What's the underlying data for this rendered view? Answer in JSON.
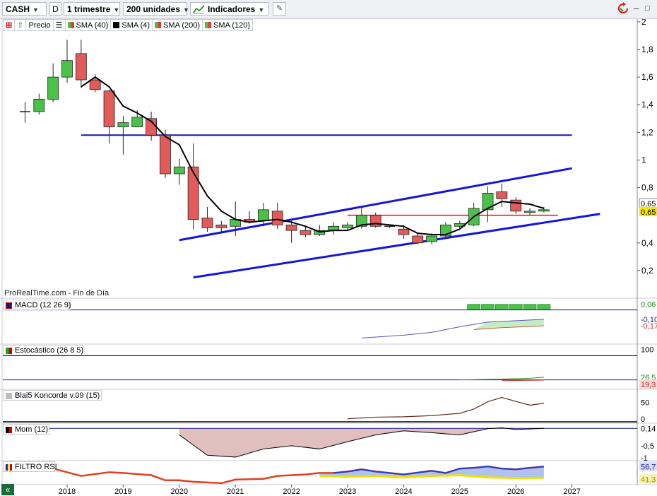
{
  "toolbar": {
    "ticker": "CASH",
    "ticker_type": "D",
    "timeframe": "1 trimestre",
    "units": "200 unidades",
    "indicators_label": "Indicadores"
  },
  "legend": [
    {
      "label": "Precio",
      "color": "#4ac24a",
      "split": false
    },
    {
      "label": "SMA (40)",
      "color": "#4ac24a",
      "split": true
    },
    {
      "label": "SMA (4)",
      "color": "#000000",
      "split": false
    },
    {
      "label": "SMA (200)",
      "color": "#4ac24a",
      "split": true
    },
    {
      "label": "SMA (120)",
      "color": "#4ac24a",
      "split": true
    }
  ],
  "watermark": "ProRealTime.com - Fin de Día",
  "panels": {
    "macd": {
      "label": "MACD (12 26 9)",
      "axis": [
        "0,06",
        "-0,10",
        "-0,17"
      ]
    },
    "stoch": {
      "label": "Estocástico (26 8 5)",
      "axis": [
        "100",
        "26,5",
        "19,3"
      ]
    },
    "koncorde": {
      "label": "Blai5 Koncorde v.09 (15)",
      "axis": [
        "50",
        "0"
      ]
    },
    "mom": {
      "label": "Mom (12)",
      "axis": [
        "0,14",
        "-0,5",
        "-1"
      ]
    },
    "rsi": {
      "label": "FILTRO RSI",
      "axis": [
        "56,7",
        "41,3"
      ]
    }
  },
  "price_axis": {
    "ticks": [
      {
        "v": 2.0,
        "t": "2"
      },
      {
        "v": 1.8,
        "t": "1,8"
      },
      {
        "v": 1.6,
        "t": "1,6"
      },
      {
        "v": 1.4,
        "t": "1,4"
      },
      {
        "v": 1.2,
        "t": "1,2"
      },
      {
        "v": 1.0,
        "t": "1"
      },
      {
        "v": 0.8,
        "t": "0,8"
      },
      {
        "v": 0.4,
        "t": "0,4"
      },
      {
        "v": 0.2,
        "t": "0,2"
      }
    ],
    "last_labels": [
      {
        "v": 0.685,
        "t": "0,65",
        "bg": "#ffffff"
      },
      {
        "v": 0.625,
        "t": "0,65",
        "bg": "#f6e700"
      }
    ]
  },
  "chart_data": {
    "type": "candlestick",
    "x_axis_labels": [
      "2018",
      "2019",
      "2020",
      "2021",
      "2022",
      "2023",
      "2024",
      "2025",
      "2026",
      "2027"
    ],
    "x_axis_years": [
      2018,
      2019,
      2020,
      2021,
      2022,
      2023,
      2024,
      2025,
      2026,
      2027
    ],
    "ylim": [
      0.0,
      2.02
    ],
    "candles": [
      {
        "t": 2017.25,
        "o": 1.35,
        "h": 1.42,
        "l": 1.27,
        "c": 1.35
      },
      {
        "t": 2017.5,
        "o": 1.35,
        "h": 1.48,
        "l": 1.33,
        "c": 1.44
      },
      {
        "t": 2017.75,
        "o": 1.44,
        "h": 1.7,
        "l": 1.42,
        "c": 1.6
      },
      {
        "t": 2018.0,
        "o": 1.6,
        "h": 1.87,
        "l": 1.56,
        "c": 1.72
      },
      {
        "t": 2018.25,
        "o": 1.77,
        "h": 1.87,
        "l": 1.52,
        "c": 1.58
      },
      {
        "t": 2018.5,
        "o": 1.58,
        "h": 1.62,
        "l": 1.49,
        "c": 1.51
      },
      {
        "t": 2018.75,
        "o": 1.5,
        "h": 1.51,
        "l": 1.12,
        "c": 1.24
      },
      {
        "t": 2019.0,
        "o": 1.24,
        "h": 1.32,
        "l": 1.04,
        "c": 1.27
      },
      {
        "t": 2019.25,
        "o": 1.24,
        "h": 1.36,
        "l": 1.24,
        "c": 1.31
      },
      {
        "t": 2019.5,
        "o": 1.3,
        "h": 1.35,
        "l": 1.14,
        "c": 1.18
      },
      {
        "t": 2019.75,
        "o": 1.18,
        "h": 1.22,
        "l": 0.87,
        "c": 0.9
      },
      {
        "t": 2020.0,
        "o": 0.9,
        "h": 1.01,
        "l": 0.82,
        "c": 0.95
      },
      {
        "t": 2020.25,
        "o": 0.95,
        "h": 1.12,
        "l": 0.5,
        "c": 0.57
      },
      {
        "t": 2020.5,
        "o": 0.58,
        "h": 0.66,
        "l": 0.48,
        "c": 0.51
      },
      {
        "t": 2020.75,
        "o": 0.53,
        "h": 0.56,
        "l": 0.47,
        "c": 0.51
      },
      {
        "t": 2021.0,
        "o": 0.52,
        "h": 0.7,
        "l": 0.45,
        "c": 0.57
      },
      {
        "t": 2021.25,
        "o": 0.57,
        "h": 0.63,
        "l": 0.54,
        "c": 0.55
      },
      {
        "t": 2021.5,
        "o": 0.56,
        "h": 0.69,
        "l": 0.52,
        "c": 0.64
      },
      {
        "t": 2021.75,
        "o": 0.63,
        "h": 0.69,
        "l": 0.5,
        "c": 0.53
      },
      {
        "t": 2022.0,
        "o": 0.53,
        "h": 0.56,
        "l": 0.4,
        "c": 0.49
      },
      {
        "t": 2022.25,
        "o": 0.49,
        "h": 0.52,
        "l": 0.44,
        "c": 0.46
      },
      {
        "t": 2022.5,
        "o": 0.46,
        "h": 0.53,
        "l": 0.45,
        "c": 0.49
      },
      {
        "t": 2022.75,
        "o": 0.49,
        "h": 0.55,
        "l": 0.46,
        "c": 0.52
      },
      {
        "t": 2023.0,
        "o": 0.51,
        "h": 0.55,
        "l": 0.49,
        "c": 0.53
      },
      {
        "t": 2023.25,
        "o": 0.52,
        "h": 0.66,
        "l": 0.5,
        "c": 0.6
      },
      {
        "t": 2023.5,
        "o": 0.6,
        "h": 0.62,
        "l": 0.51,
        "c": 0.52
      },
      {
        "t": 2023.75,
        "o": 0.52,
        "h": 0.53,
        "l": 0.51,
        "c": 0.52
      },
      {
        "t": 2024.0,
        "o": 0.5,
        "h": 0.53,
        "l": 0.43,
        "c": 0.46
      },
      {
        "t": 2024.25,
        "o": 0.45,
        "h": 0.47,
        "l": 0.39,
        "c": 0.4
      },
      {
        "t": 2024.5,
        "o": 0.41,
        "h": 0.47,
        "l": 0.39,
        "c": 0.45
      },
      {
        "t": 2024.75,
        "o": 0.45,
        "h": 0.55,
        "l": 0.43,
        "c": 0.53
      },
      {
        "t": 2025.0,
        "o": 0.52,
        "h": 0.56,
        "l": 0.5,
        "c": 0.54
      },
      {
        "t": 2025.25,
        "o": 0.53,
        "h": 0.69,
        "l": 0.52,
        "c": 0.65
      },
      {
        "t": 2025.5,
        "o": 0.64,
        "h": 0.81,
        "l": 0.55,
        "c": 0.76
      },
      {
        "t": 2025.75,
        "o": 0.77,
        "h": 0.83,
        "l": 0.66,
        "c": 0.72
      },
      {
        "t": 2026.0,
        "o": 0.71,
        "h": 0.73,
        "l": 0.61,
        "c": 0.63
      },
      {
        "t": 2026.25,
        "o": 0.62,
        "h": 0.65,
        "l": 0.6,
        "c": 0.63
      },
      {
        "t": 2026.5,
        "o": 0.63,
        "h": 0.66,
        "l": 0.62,
        "c": 0.64
      }
    ],
    "sma4": [
      [
        2018.25,
        1.53
      ],
      [
        2018.5,
        1.6
      ],
      [
        2018.75,
        1.53
      ],
      [
        2019.0,
        1.39
      ],
      [
        2019.25,
        1.34
      ],
      [
        2019.5,
        1.28
      ],
      [
        2019.75,
        1.17
      ],
      [
        2020.0,
        1.11
      ],
      [
        2020.25,
        0.91
      ],
      [
        2020.5,
        0.74
      ],
      [
        2020.75,
        0.63
      ],
      [
        2021.0,
        0.57
      ],
      [
        2021.25,
        0.55
      ],
      [
        2021.5,
        0.56
      ],
      [
        2021.75,
        0.57
      ],
      [
        2022.0,
        0.55
      ],
      [
        2022.25,
        0.52
      ],
      [
        2022.5,
        0.48
      ],
      [
        2022.75,
        0.49
      ],
      [
        2023.0,
        0.49
      ],
      [
        2023.25,
        0.53
      ],
      [
        2023.5,
        0.54
      ],
      [
        2023.75,
        0.53
      ],
      [
        2024.0,
        0.52
      ],
      [
        2024.25,
        0.47
      ],
      [
        2024.5,
        0.46
      ],
      [
        2024.75,
        0.46
      ],
      [
        2025.0,
        0.5
      ],
      [
        2025.25,
        0.59
      ],
      [
        2025.5,
        0.65
      ],
      [
        2025.75,
        0.7
      ],
      [
        2026.0,
        0.69
      ],
      [
        2026.25,
        0.68
      ],
      [
        2026.5,
        0.65
      ]
    ],
    "drawn_lines": [
      {
        "name": "resistance",
        "color": "#1515b0",
        "p1": [
          2018.25,
          1.18
        ],
        "p2": [
          2027.0,
          1.18
        ]
      },
      {
        "name": "upper-channel",
        "color": "#1515dd",
        "p1": [
          2020.0,
          0.42
        ],
        "p2": [
          2027.0,
          0.94
        ]
      },
      {
        "name": "lower-channel",
        "color": "#1515dd",
        "p1": [
          2020.25,
          0.15
        ],
        "p2": [
          2027.5,
          0.61
        ]
      },
      {
        "name": "support-red",
        "color": "#e01010",
        "p1": [
          2023.0,
          0.6
        ],
        "p2": [
          2026.75,
          0.6
        ]
      }
    ],
    "indicators": {
      "macd_histogram": [
        [
          2025.25,
          0.06
        ],
        [
          2025.5,
          0.06
        ],
        [
          2025.75,
          0.06
        ],
        [
          2026.0,
          0.06
        ],
        [
          2026.25,
          0.06
        ],
        [
          2026.5,
          0.06
        ]
      ],
      "macd_line": [
        [
          2023.25,
          -0.3
        ],
        [
          2024.0,
          -0.27
        ],
        [
          2024.5,
          -0.24
        ],
        [
          2025.0,
          -0.18
        ],
        [
          2025.5,
          -0.13
        ],
        [
          2026.5,
          -0.1
        ]
      ],
      "macd_signal": [
        [
          2025.25,
          -0.21
        ],
        [
          2025.75,
          -0.19
        ],
        [
          2026.5,
          -0.17
        ]
      ],
      "stoch_k": [
        [
          2025.0,
          20
        ],
        [
          2025.75,
          22
        ],
        [
          2026.25,
          24
        ],
        [
          2026.5,
          26.5
        ]
      ],
      "stoch_d": [
        [
          2025.75,
          18
        ],
        [
          2026.5,
          19.3
        ]
      ],
      "koncorde": [
        [
          2023.0,
          8
        ],
        [
          2023.5,
          12
        ],
        [
          2024.0,
          13
        ],
        [
          2024.5,
          16
        ],
        [
          2025.0,
          22
        ],
        [
          2025.25,
          33
        ],
        [
          2025.5,
          52
        ],
        [
          2025.75,
          63
        ],
        [
          2026.0,
          53
        ],
        [
          2026.25,
          43
        ],
        [
          2026.5,
          48
        ]
      ],
      "mom": [
        [
          2020.0,
          -0.1
        ],
        [
          2020.5,
          -0.85
        ],
        [
          2021.0,
          -0.92
        ],
        [
          2021.5,
          -0.62
        ],
        [
          2022.0,
          -0.5
        ],
        [
          2022.5,
          -0.62
        ],
        [
          2023.0,
          -0.35
        ],
        [
          2023.5,
          -0.1
        ],
        [
          2024.0,
          0.05
        ],
        [
          2024.5,
          -0.02
        ],
        [
          2025.0,
          -0.1
        ],
        [
          2025.5,
          0.13
        ],
        [
          2025.75,
          0.16
        ],
        [
          2026.0,
          0.1
        ],
        [
          2026.5,
          0.14
        ]
      ],
      "rsi": [
        [
          2017.25,
          56
        ],
        [
          2017.75,
          54
        ],
        [
          2018.25,
          44
        ],
        [
          2018.75,
          49
        ],
        [
          2019.0,
          48
        ],
        [
          2019.5,
          45
        ],
        [
          2019.75,
          38
        ],
        [
          2020.0,
          38
        ],
        [
          2020.25,
          36
        ],
        [
          2020.75,
          34
        ],
        [
          2021.0,
          39
        ],
        [
          2021.5,
          40
        ],
        [
          2021.75,
          44
        ],
        [
          2022.0,
          45
        ],
        [
          2022.25,
          46
        ],
        [
          2022.5,
          48
        ],
        [
          2022.75,
          48
        ],
        [
          2023.0,
          50
        ],
        [
          2023.25,
          53
        ],
        [
          2023.5,
          50
        ],
        [
          2023.75,
          48
        ],
        [
          2024.0,
          46
        ],
        [
          2024.5,
          51
        ],
        [
          2024.75,
          48
        ],
        [
          2025.0,
          54
        ],
        [
          2025.25,
          55
        ],
        [
          2025.5,
          57
        ],
        [
          2025.75,
          54
        ],
        [
          2026.0,
          53
        ],
        [
          2026.25,
          55
        ],
        [
          2026.5,
          56.7
        ]
      ],
      "rsi_signal": [
        [
          2022.5,
          44
        ],
        [
          2023.0,
          43
        ],
        [
          2023.5,
          44
        ],
        [
          2024.0,
          42
        ],
        [
          2024.5,
          44
        ],
        [
          2025.0,
          45
        ],
        [
          2025.5,
          42
        ],
        [
          2026.0,
          41
        ],
        [
          2026.5,
          41.3
        ]
      ]
    }
  }
}
